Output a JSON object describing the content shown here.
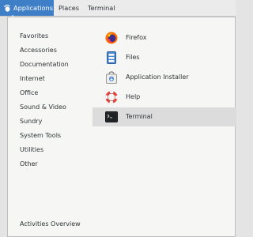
{
  "topbar": {
    "applications_label": "Applications",
    "places_label": "Places",
    "terminal_label": "Terminal"
  },
  "categories": [
    "Favorites",
    "Accessories",
    "Documentation",
    "Internet",
    "Office",
    "Sound & Video",
    "Sundry",
    "System Tools",
    "Utilities",
    "Other"
  ],
  "apps": [
    {
      "label": "Firefox",
      "icon": "firefox-icon"
    },
    {
      "label": "Files",
      "icon": "files-icon"
    },
    {
      "label": "Application Installer",
      "icon": "software-icon"
    },
    {
      "label": "Help",
      "icon": "help-icon"
    },
    {
      "label": "Terminal",
      "icon": "terminal-icon",
      "selected": true
    }
  ],
  "footer": {
    "activities_overview_label": "Activities Overview"
  },
  "colors": {
    "accent": "#3f7fc8",
    "selected_row": "#dcdcdc",
    "menu_bg": "#f6f6f5"
  }
}
